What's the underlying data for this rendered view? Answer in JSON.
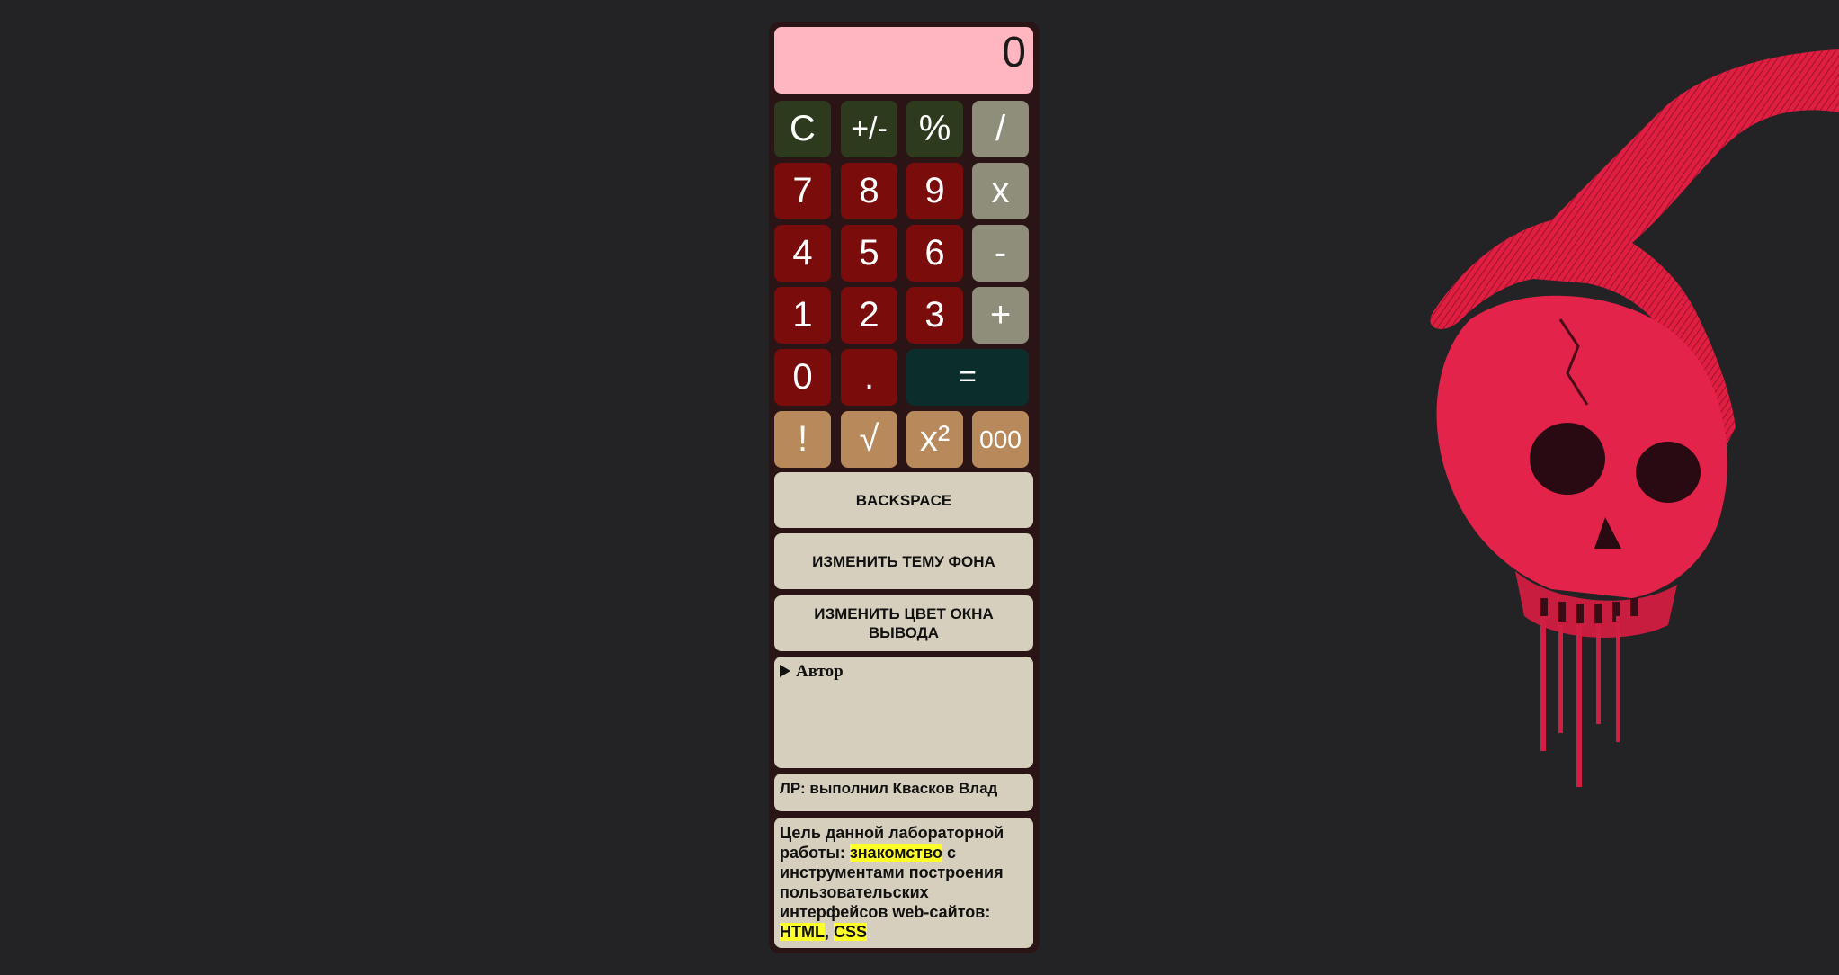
{
  "display": {
    "value": "0",
    "background": "#ffb6c1"
  },
  "keypad": {
    "row1": [
      "C",
      "+/-",
      "%",
      "/"
    ],
    "row2": [
      "7",
      "8",
      "9",
      "x"
    ],
    "row3": [
      "4",
      "5",
      "6",
      "-"
    ],
    "row4": [
      "1",
      "2",
      "3",
      "+"
    ],
    "row5": [
      "0",
      ".",
      "="
    ],
    "row6": [
      "!",
      "√",
      "x²",
      "000"
    ]
  },
  "actions": {
    "backspace": "BACKSPACE",
    "change_theme": "ИЗМЕНИТЬ ТЕМУ ФОНА",
    "change_output_color": "ИЗМЕНИТЬ ЦВЕТ ОКНА ВЫВОДА"
  },
  "author": {
    "summary": "Автор",
    "credit": "ЛР: выполнил Квасков Влад"
  },
  "goal": {
    "prefix": "Цель данной лабораторной работы: ",
    "highlight1": "знакомство",
    "middle": " с инструментами построения пользовательских интерфейсов web-сайтов: ",
    "highlight2": "HTML",
    "sep": ", ",
    "highlight3": "CSS"
  },
  "colors": {
    "page_bg": "#232325",
    "func_btn": "#2d3a1d",
    "num_btn": "#7a0c0c",
    "op_btn": "#8e8e7a",
    "eq_btn": "#0b2e2c",
    "extra_btn": "#b8895a",
    "panel_bg": "#d6cfbd",
    "highlight": "#ffff2a"
  },
  "background_image": {
    "icon": "red-skull-hand-art"
  }
}
